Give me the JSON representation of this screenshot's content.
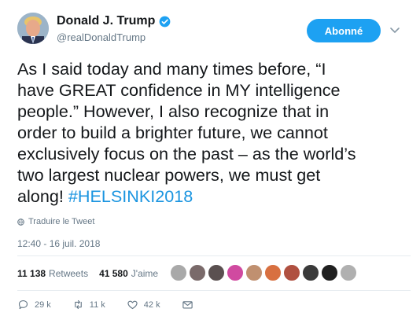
{
  "author": {
    "name": "Donald J. Trump",
    "handle": "@realDonaldTrump",
    "verified": true
  },
  "follow_button": {
    "label": "Abonné"
  },
  "tweet": {
    "text": "As I said today and many times before, “I\nhave GREAT confidence in MY intelligence\npeople.” However, I also recognize that in\norder to build a brighter future, we cannot\nexclusively focus on the past – as the world’s\ntwo largest nuclear powers, we must get\nalong! ",
    "hashtag": "#HELSINKI2018"
  },
  "translate_label": "Traduire le Tweet",
  "timestamp": "12:40 - 16 juil. 2018",
  "stats": {
    "retweets_count": "11 138",
    "retweets_label": "Retweets",
    "likes_count": "41 580",
    "likes_label": "J'aime"
  },
  "liker_colors": [
    "#a9a9a9",
    "#7a6a6a",
    "#5a5050",
    "#d04aa0",
    "#c09070",
    "#d87040",
    "#b05040",
    "#3a3a3a",
    "#202020",
    "#b0b0b0"
  ],
  "actions": {
    "replies": "29 k",
    "retweets": "11 k",
    "likes": "42 k"
  },
  "colors": {
    "accent": "#1da1f2",
    "hashtag": "#1b95e0",
    "muted": "#657786"
  }
}
